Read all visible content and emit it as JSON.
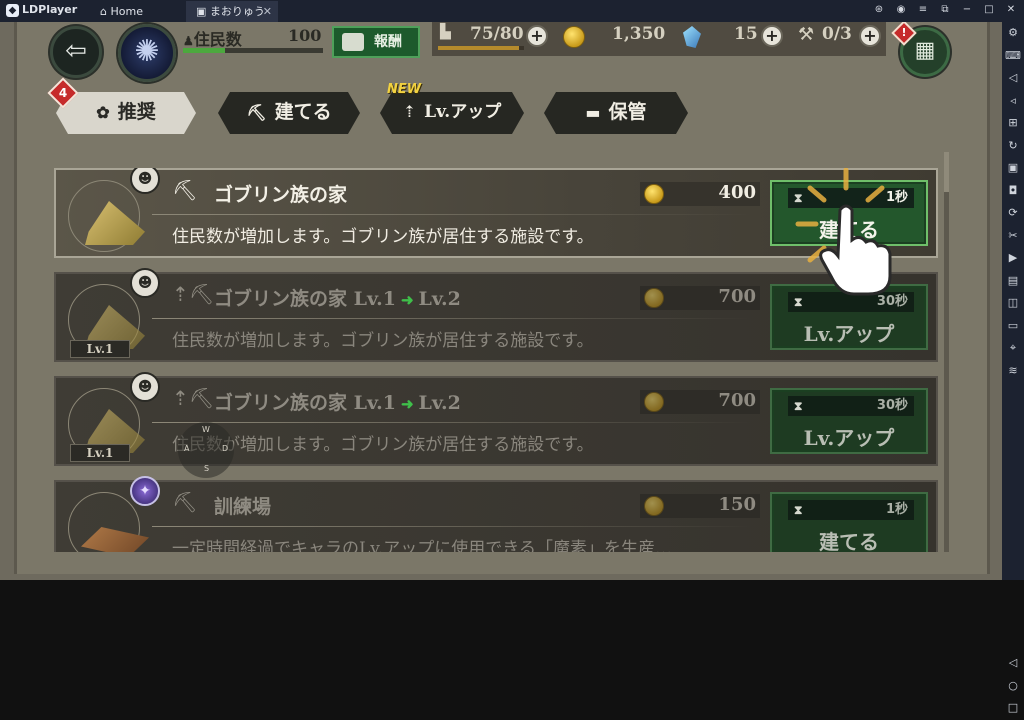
{
  "window": {
    "app_name": "LDPlayer",
    "tabs": [
      {
        "label": "Home"
      },
      {
        "label": "まおりゅう"
      }
    ]
  },
  "hud": {
    "population_label": "住民数",
    "population_value": "100",
    "population_fill": 0.3,
    "reward_label": "報酬",
    "stamina": "75/80",
    "stamina_fill": 0.94,
    "gold": "1,350",
    "crystals": "15",
    "hammers": "0/3",
    "alert_icon": "!"
  },
  "tabs": {
    "badge": "4",
    "new_label": "NEW",
    "items": [
      {
        "label": "推奨",
        "icon": "gear-cluster-icon",
        "active": true
      },
      {
        "label": "建てる",
        "icon": "pickaxe-icon",
        "active": false
      },
      {
        "label": "Lv.アップ",
        "icon": "level-up-icon",
        "active": false
      },
      {
        "label": "保管",
        "icon": "storage-box-icon",
        "active": false
      }
    ]
  },
  "list": [
    {
      "name": "ゴブリン族の家",
      "from_level": "",
      "to_level": "",
      "level_badge": "",
      "description": "住民数が増加します。ゴブリン族が居住する施設です。",
      "cost": "400",
      "time": "1秒",
      "action": "建てる",
      "dim": false,
      "type_icon": "pickaxe-icon",
      "badge_icon": "residents-icon",
      "image": "straw-tent"
    },
    {
      "name": "ゴブリン族の家",
      "from_level": "Lv.1",
      "to_level": "Lv.2",
      "level_badge": "Lv.1",
      "description": "住民数が増加します。ゴブリン族が居住する施設です。",
      "cost": "700",
      "time": "30秒",
      "action": "Lv.アップ",
      "dim": true,
      "type_icon": "level-up-icon",
      "badge_icon": "residents-icon",
      "image": "straw-tent"
    },
    {
      "name": "ゴブリン族の家",
      "from_level": "Lv.1",
      "to_level": "Lv.2",
      "level_badge": "Lv.1",
      "description": "住民数が増加します。ゴブリン族が居住する施設です。",
      "cost": "700",
      "time": "30秒",
      "action": "Lv.アップ",
      "dim": true,
      "type_icon": "level-up-icon",
      "badge_icon": "residents-icon",
      "image": "straw-tent"
    },
    {
      "name": "訓練場",
      "from_level": "",
      "to_level": "",
      "level_badge": "",
      "description": "一定時間経過でキャラのLv.アップに使用できる「魔素」を生産…",
      "cost": "150",
      "time": "1秒",
      "action": "建てる",
      "dim": true,
      "type_icon": "pickaxe-icon",
      "badge_icon": "magic-orb-icon",
      "image": "arena"
    }
  ],
  "joystick": {
    "up": "W",
    "left": "A",
    "right": "D",
    "down": "S"
  },
  "colors": {
    "accent_green": "#23572c",
    "level_arrow": "#3fbf4a",
    "alert_red": "#c62b2b"
  }
}
